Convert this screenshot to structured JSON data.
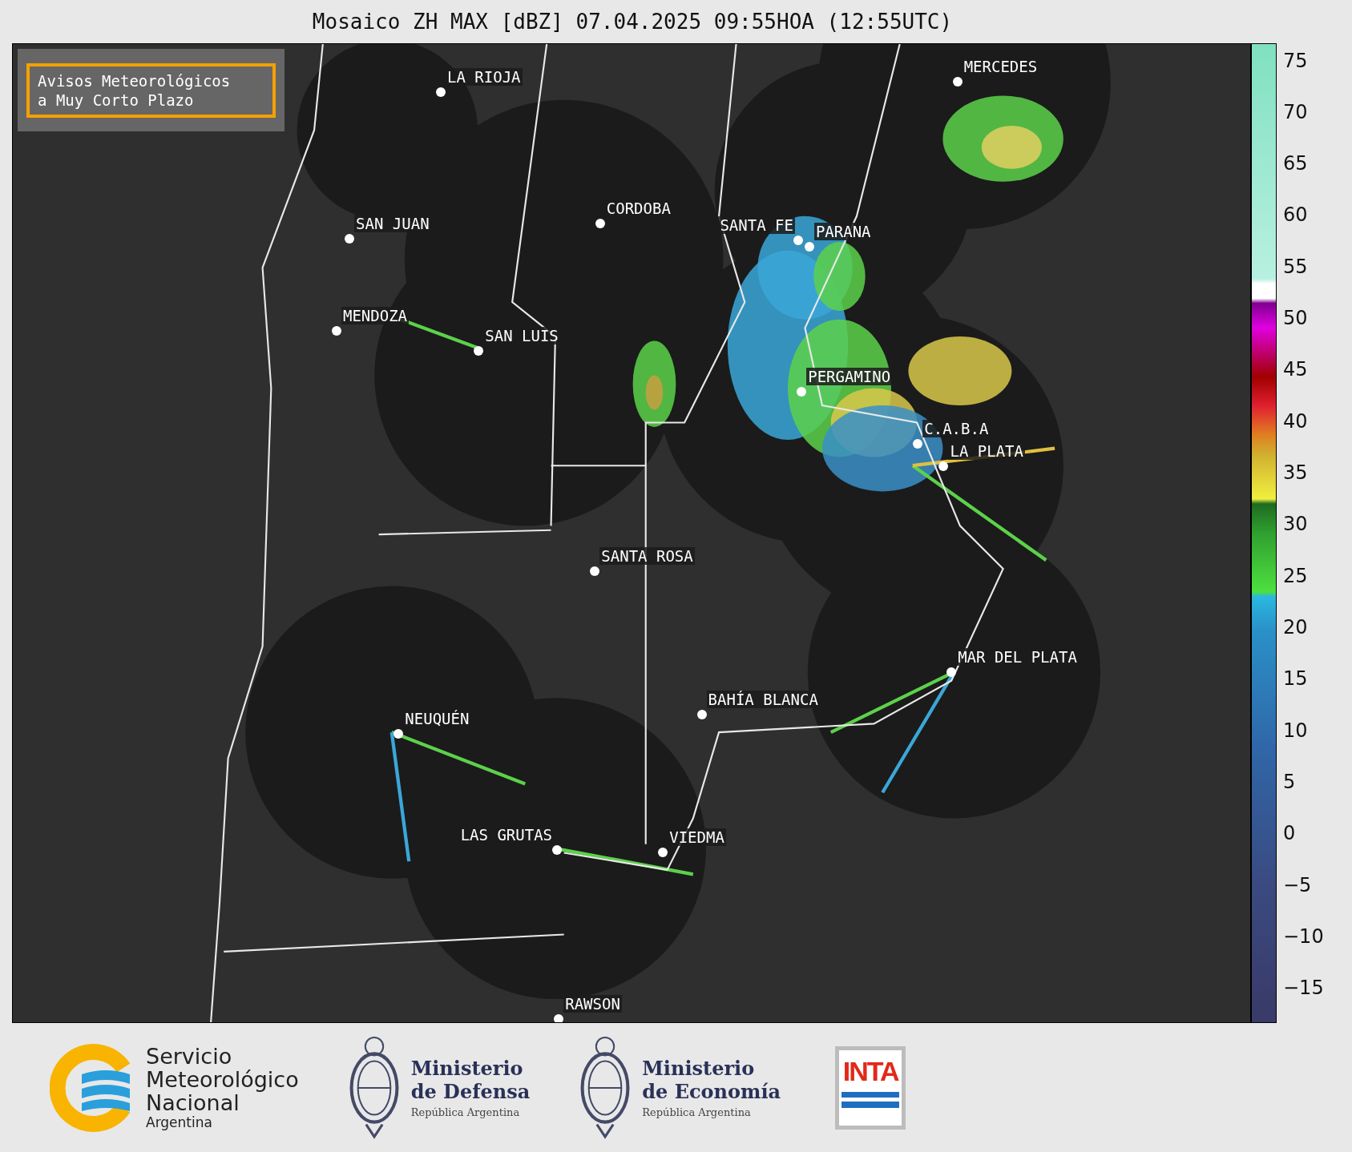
{
  "title": "Mosaico ZH MAX [dBZ] 07.04.2025 09:55HOA (12:55UTC)",
  "alert_box": {
    "lines": [
      "Avisos Meteorológicos",
      "a Muy Corto Plazo"
    ]
  },
  "cities": [
    "MERCEDES",
    "LA RIOJA",
    "CORDOBA",
    "SAN JUAN",
    "SANTA FE",
    "PARANA",
    "MENDOZA",
    "SAN LUIS",
    "PERGAMINO",
    "C.A.B.A",
    "LA PLATA",
    "SANTA ROSA",
    "MAR DEL PLATA",
    "BAHÍA BLANCA",
    "NEUQUÉN",
    "LAS GRUTAS",
    "VIEDMA",
    "RAWSON"
  ],
  "colorbar": {
    "ticks": [
      "75",
      "70",
      "65",
      "60",
      "55",
      "50",
      "45",
      "40",
      "35",
      "30",
      "25",
      "20",
      "15",
      "10",
      "5",
      "0",
      "−5",
      "−10",
      "−15"
    ]
  },
  "logos": [
    {
      "kind": "smn",
      "lines": [
        "Servicio",
        "Meteorológico",
        "Nacional"
      ],
      "subtitle": "Argentina"
    },
    {
      "kind": "ministry",
      "lines": [
        "Ministerio",
        "de Defensa"
      ],
      "subtitle": "República Argentina"
    },
    {
      "kind": "ministry",
      "lines": [
        "Ministerio",
        "de Economía"
      ],
      "subtitle": "República Argentina"
    },
    {
      "kind": "inta",
      "text": "INTA"
    }
  ]
}
